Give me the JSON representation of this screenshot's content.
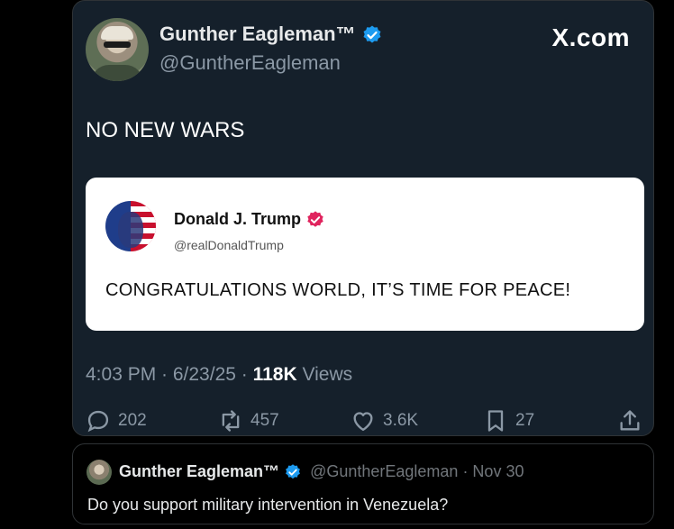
{
  "tweet": {
    "author_name": "Gunther Eagleman™",
    "author_handle": "@GuntherEagleman",
    "brand": "X.com",
    "text": "NO NEW WARS",
    "quoted": {
      "author_name": "Donald J. Trump",
      "author_handle": "@realDonaldTrump",
      "text": "CONGRATULATIONS WORLD, IT’S TIME FOR PEACE!"
    },
    "time": "4:03 PM · 6/23/25 · ",
    "views_count": "118K",
    "views_label": " Views",
    "actions": {
      "replies": "202",
      "reposts": "457",
      "likes": "3.6K",
      "bookmarks": "27"
    }
  },
  "reply_post": {
    "author_name": "Gunther Eagleman™",
    "author_handle": "@GuntherEagleman",
    "date": " · Nov 30",
    "text": "Do you support military intervention in Venezuela?"
  },
  "colors": {
    "card_bg": "#15202b",
    "verified_blue": "#1d9bf0",
    "verified_pink": "#e0245e"
  }
}
